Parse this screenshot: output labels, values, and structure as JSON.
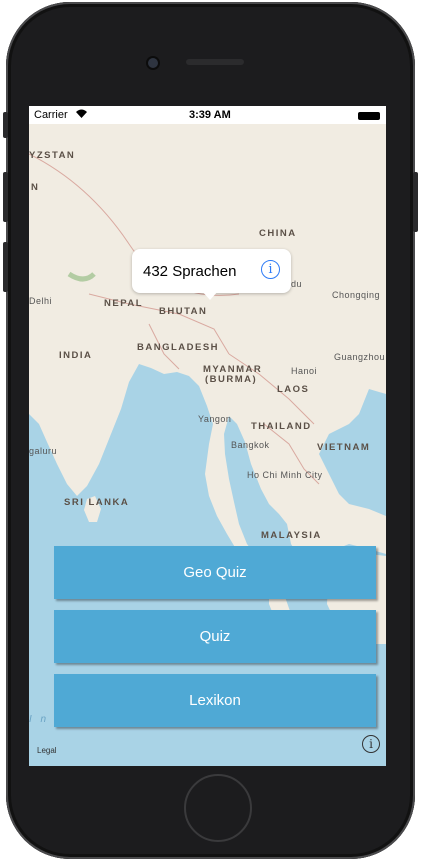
{
  "status_bar": {
    "carrier": "Carrier",
    "time": "3:39 AM"
  },
  "map": {
    "labels": {
      "kyrgyzstan": "YZSTAN",
      "n": "N",
      "china": "CHINA",
      "delhi": "Delhi",
      "nepal": "NEPAL",
      "bhutan": "BHUTAN",
      "chengdu": "du",
      "chongqing": "Chongqing",
      "india": "INDIA",
      "bangladesh": "BANGLADESH",
      "myanmar": "MYANMAR",
      "burma": "(BURMA)",
      "hanoi": "Hanoi",
      "guangzhou": "Guangzhou",
      "laos": "LAOS",
      "yangon": "Yangon",
      "thailand": "THAILAND",
      "bangkok": "Bangkok",
      "vietnam": "VIETNAM",
      "bengaluru": "galuru",
      "ho_chi_minh": "Ho Chi Minh City",
      "sri_lanka": "SRI LANKA",
      "malaysia": "MALAYSIA",
      "indian_ocean": "I n d"
    },
    "legal": "Legal"
  },
  "callout": {
    "text": "432 Sprachen"
  },
  "buttons": {
    "geo_quiz": "Geo Quiz",
    "quiz": "Quiz",
    "lexikon": "Lexikon"
  },
  "colors": {
    "button": "#4fa9d5",
    "water": "#a9d3e6",
    "land": "#f1ece2",
    "accent": "#2f7cf6"
  },
  "icons": {
    "callout_info": "info-icon",
    "map_info": "info-icon",
    "wifi": "wifi-icon",
    "battery": "battery-icon"
  }
}
